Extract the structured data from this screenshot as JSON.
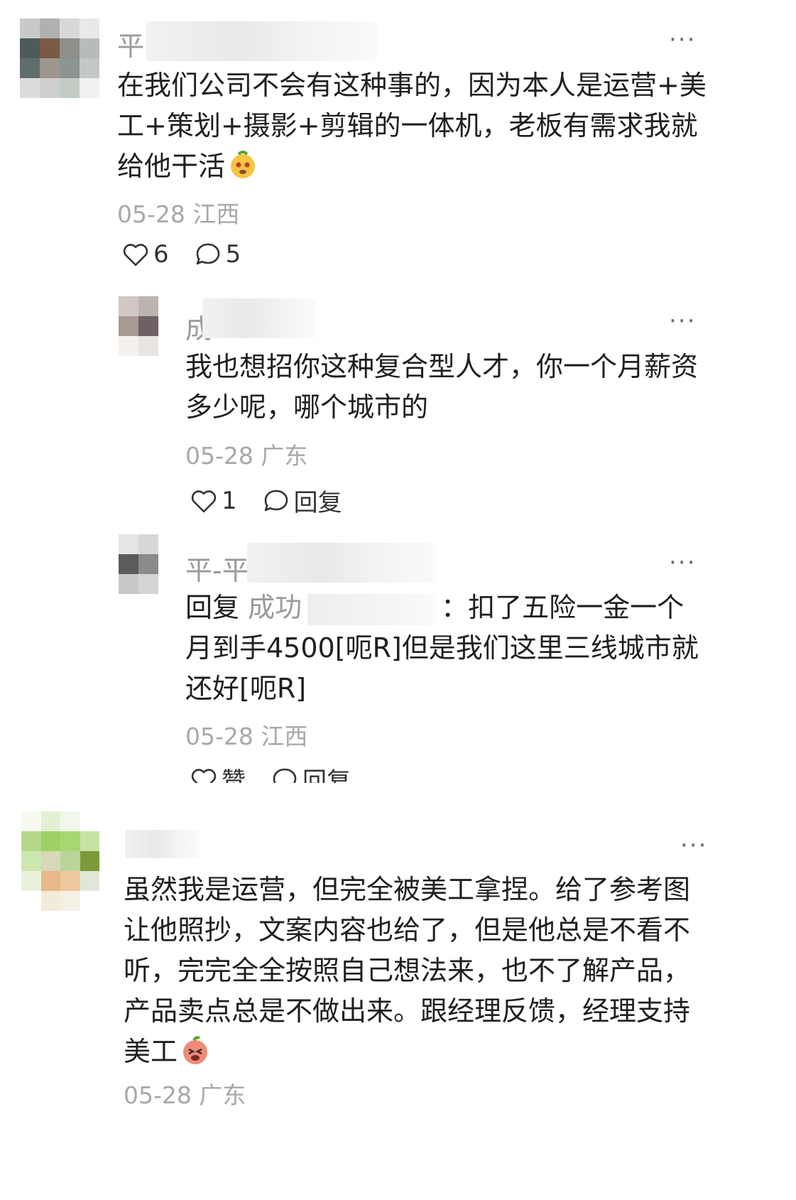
{
  "comments": [
    {
      "name_visible": "平",
      "text": "在我们公司不会有这种事的，因为本人是运营+美工+策划+摄影+剪辑的一体机，老板有需求我就给他干活",
      "date": "05-28",
      "region": "江西",
      "likes": "6",
      "replies_count": "5",
      "replies": [
        {
          "name_visible": "成",
          "text": "我也想招你这种复合型人才，你一个月薪资多少呢，哪个城市的",
          "date": "05-28",
          "region": "广东",
          "likes": "1",
          "reply_label": "回复"
        },
        {
          "name_visible": "平-平",
          "reply_prefix": "回复",
          "reply_to_visible": "成功",
          "text": "：扣了五险一金一个月到手4500[呃R]但是我们这里三线城市就还好[呃R]",
          "date": "05-28",
          "region": "江西",
          "like_label": "赞",
          "reply_label": "回复"
        }
      ]
    },
    {
      "name_visible": "",
      "text": "虽然我是运营，但完全被美工拿捏。给了参考图让他照抄，文案内容也给了，但是他总是不看不听，完完全全按照自己想法来，也不了解产品，产品卖点总是不做出来。跟经理反馈，经理支持美工",
      "date": "05-28",
      "region": "广东"
    }
  ],
  "more_label": "···",
  "icons": {
    "like": "heart-outline-icon",
    "comment": "chat-bubble-icon",
    "more": "more-dots-icon"
  },
  "colors": {
    "text": "#1f1f1f",
    "meta": "#a8a8a8",
    "name": "#9a9a9a"
  }
}
